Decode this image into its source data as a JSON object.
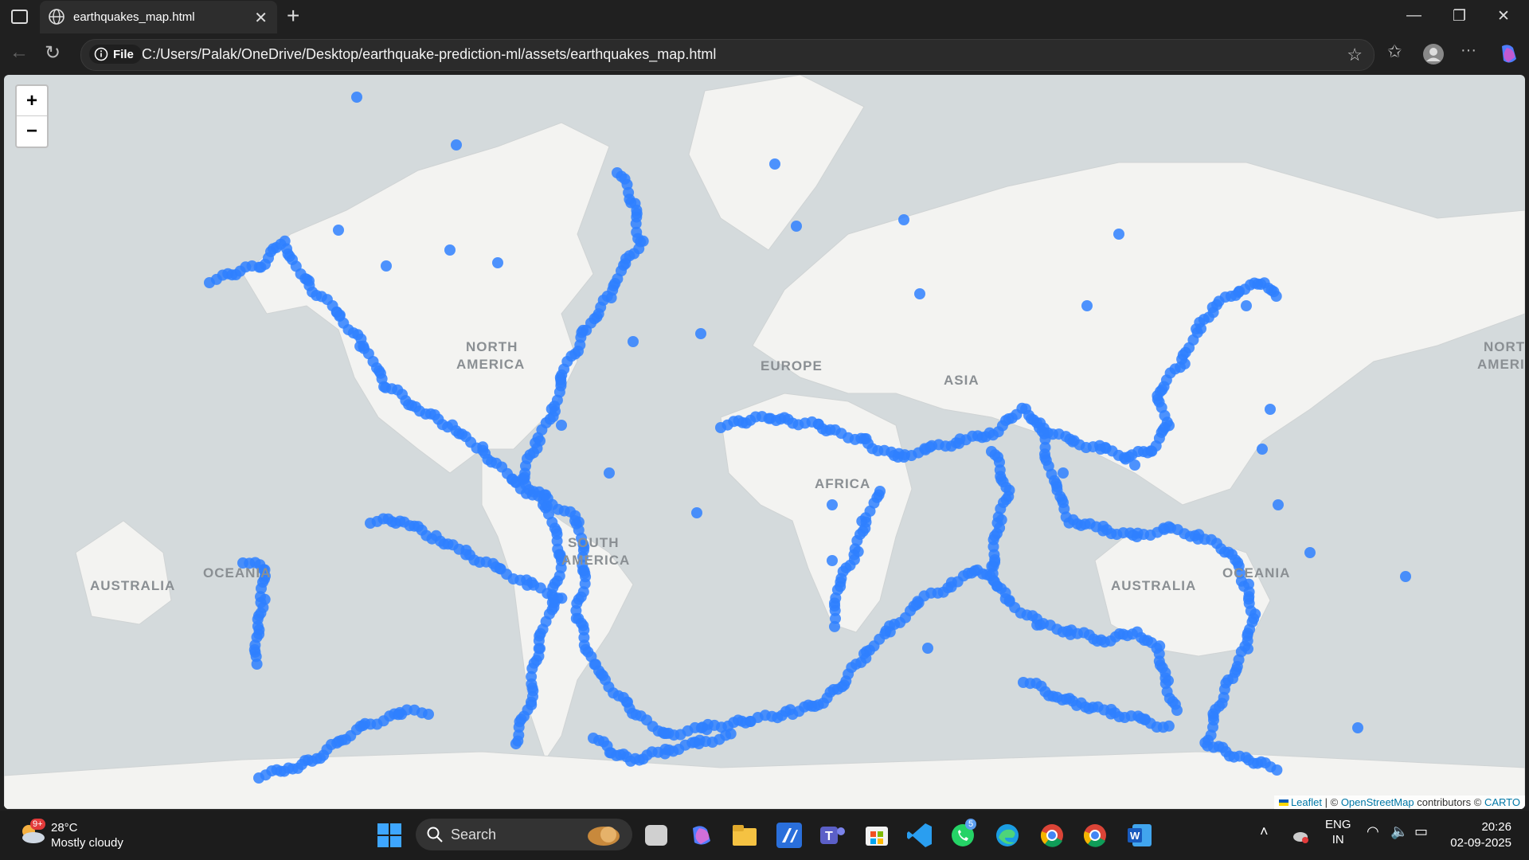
{
  "browser": {
    "tab_title": "earthquakes_map.html",
    "address_label": "File",
    "url": "C:/Users/Palak/OneDrive/Desktop/earthquake-prediction-ml/assets/earthquakes_map.html"
  },
  "map": {
    "labels": {
      "north_america_1": "NORTH",
      "north_america_2": "AMERICA",
      "south_america_1": "SOUTH",
      "south_america_2": "AMERICA",
      "africa": "AFRICA",
      "australia_left": "AUSTRALIA",
      "australia_right": "AUSTRALIA",
      "oceania_left": "OCEANIA",
      "oceania_right": "OCEANIA",
      "europe": "EUROPE",
      "asia": "ASIA",
      "north_america_right_1": "NORT",
      "north_america_right_2": "AMERI"
    },
    "zoom_in": "+",
    "zoom_out": "−",
    "attribution": {
      "leaflet": "Leaflet",
      "sep": "| ©",
      "osm": "OpenStreetMap",
      "contrib": "contributors ©",
      "carto": "CARTO"
    },
    "marker_color": "#2f80ff",
    "water_color": "#d4dadc",
    "land_color": "#f2f2f0"
  },
  "taskbar": {
    "weather_temp": "28°C",
    "weather_desc": "Mostly cloudy",
    "weather_badge": "9+",
    "search_label": "Search",
    "teams_badge": "5",
    "lang_1": "ENG",
    "lang_2": "IN",
    "time": "20:26",
    "date": "02-09-2025"
  }
}
